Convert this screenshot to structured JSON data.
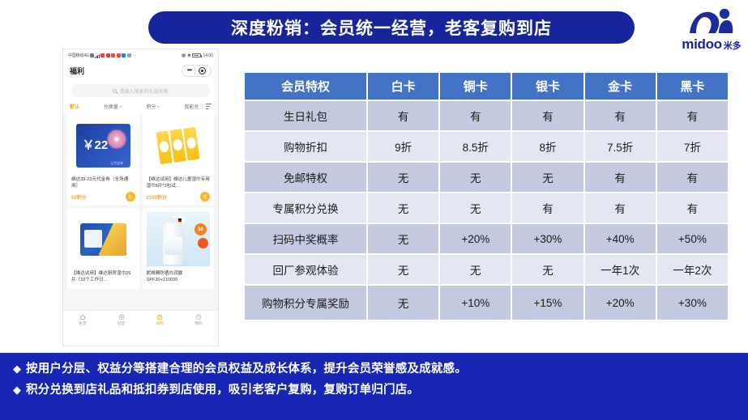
{
  "banner": {
    "title": "深度粉销：会员统一经营，老客复购到店"
  },
  "logo": {
    "latin": "midoo",
    "cn": "米多",
    "mark": "person-swoosh-logo"
  },
  "phone": {
    "status": {
      "carrier": "中国移动4G",
      "time": "14:00"
    },
    "header": {
      "title": "福利",
      "more_icon": "more-dots-icon",
      "target_icon": "target-icon"
    },
    "search": {
      "placeholder": "请输入搜索的礼品名称",
      "icon": "search-icon"
    },
    "tabs": [
      {
        "label": "默认",
        "active": true,
        "sort": false
      },
      {
        "label": "兑换量",
        "active": false,
        "sort": true
      },
      {
        "label": "积分",
        "active": false,
        "sort": true
      },
      {
        "label": "我能兑",
        "active": false,
        "sort": false
      }
    ],
    "filter_icon": "filter-list-icon",
    "cards": [
      {
        "name": "维达39-22元代金券（全场通用）",
        "points": "50积分",
        "art": "voucher",
        "amount": "￥22",
        "amount_sub": "元代金券",
        "action_icon": "exchange-icon"
      },
      {
        "name": "【维达试用】维达儿童湿巾专用湿巾8片*3包试…",
        "points": "2100积分",
        "art": "wipes",
        "action_icon": "exchange-icon"
      },
      {
        "name": "【维达试用】维达厨房湿巾26片（10个工作日…",
        "points": "",
        "art": "pack",
        "action_icon": "exchange-icon"
      },
      {
        "name": "妮维雅防晒白润露SPF30+110039",
        "points": "",
        "art": "bottle",
        "badge": "30",
        "action_icon": "exchange-icon"
      }
    ],
    "nav": [
      {
        "label": "主页",
        "icon": "home-icon",
        "active": false
      },
      {
        "label": "社区",
        "icon": "compass-icon",
        "active": false
      },
      {
        "label": "福利",
        "icon": "gift-bag-icon",
        "active": true
      },
      {
        "label": "我的",
        "icon": "user-clock-icon",
        "active": false
      }
    ]
  },
  "table": {
    "headers": [
      "会员特权",
      "白卡",
      "铜卡",
      "银卡",
      "金卡",
      "黑卡"
    ],
    "rows": [
      {
        "label": "生日礼包",
        "values": [
          "有",
          "有",
          "有",
          "有",
          "有"
        ]
      },
      {
        "label": "购物折扣",
        "values": [
          "9折",
          "8.5折",
          "8折",
          "7.5折",
          "7折"
        ]
      },
      {
        "label": "免邮特权",
        "values": [
          "无",
          "无",
          "无",
          "有",
          "有"
        ]
      },
      {
        "label": "专属积分兑换",
        "values": [
          "无",
          "无",
          "有",
          "有",
          "有"
        ]
      },
      {
        "label": "扫码中奖概率",
        "values": [
          "无",
          "+20%",
          "+30%",
          "+40%",
          "+50%"
        ]
      },
      {
        "label": "回厂参观体验",
        "values": [
          "无",
          "无",
          "无",
          "一年1次",
          "一年2次"
        ]
      },
      {
        "label": "购物积分专属奖励",
        "values": [
          "无",
          "+10%",
          "+15%",
          "+20%",
          "+30%"
        ]
      }
    ]
  },
  "footer": {
    "bullet": "◆",
    "lines": [
      "按用户分层、权益分等搭建合理的会员权益及成长体系，提升会员荣誉感及成就感。",
      "积分兑换到店礼品和抵扣券到店使用，吸引老客户复购，复购订单归门店。"
    ]
  },
  "colors": {
    "banner_blue": "#17249B",
    "footer_blue": "#1726B5",
    "table_header": "#4472C4",
    "row_dark": "#C3C9DE",
    "row_light": "#E3E7F1",
    "accent_orange": "#F5A623"
  }
}
